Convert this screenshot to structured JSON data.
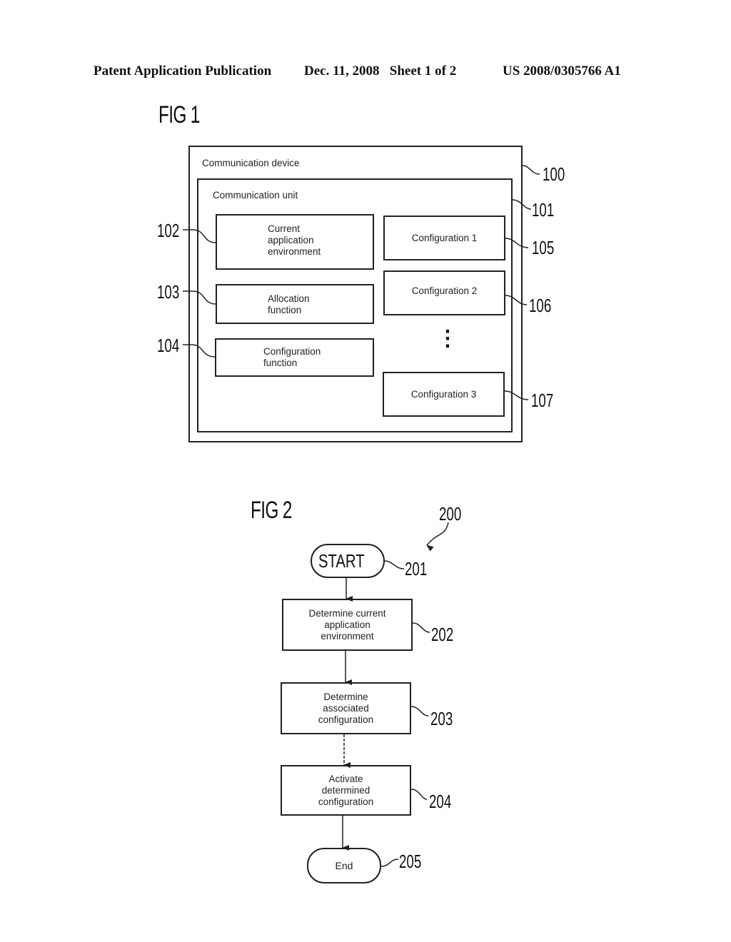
{
  "header": {
    "publication_type": "Patent Application Publication",
    "date_sheet": "Dec. 11, 2008   Sheet 1 of 2",
    "publication_number": "US 2008/0305766 A1"
  },
  "fig1": {
    "title": "FIG 1",
    "device": {
      "label": "Communication device",
      "ref": "100"
    },
    "unit": {
      "label": "Communication unit",
      "ref": "101"
    },
    "left_blocks": [
      {
        "lines": [
          "Current",
          "application",
          "environment"
        ],
        "ref": "102"
      },
      {
        "lines": [
          "Allocation",
          "function"
        ],
        "ref": "103"
      },
      {
        "lines": [
          "Configuration",
          "function"
        ],
        "ref": "104"
      }
    ],
    "configurations": [
      {
        "label": "Configuration 1",
        "ref": "105"
      },
      {
        "label": "Configuration 2",
        "ref": "106"
      },
      {
        "label": "Configuration 3",
        "ref": "107"
      }
    ],
    "ellipsis": "⋮"
  },
  "fig2": {
    "title": "FIG 2",
    "ref": "200",
    "start": {
      "label": "START",
      "ref": "201"
    },
    "steps": [
      {
        "lines": [
          "Determine current",
          "application",
          "environment"
        ],
        "ref": "202"
      },
      {
        "lines": [
          "Determine",
          "associated",
          "configuration"
        ],
        "ref": "203"
      },
      {
        "lines": [
          "Activate",
          "determined",
          "configuration"
        ],
        "ref": "204"
      }
    ],
    "end": {
      "label": "End",
      "ref": "205"
    }
  }
}
